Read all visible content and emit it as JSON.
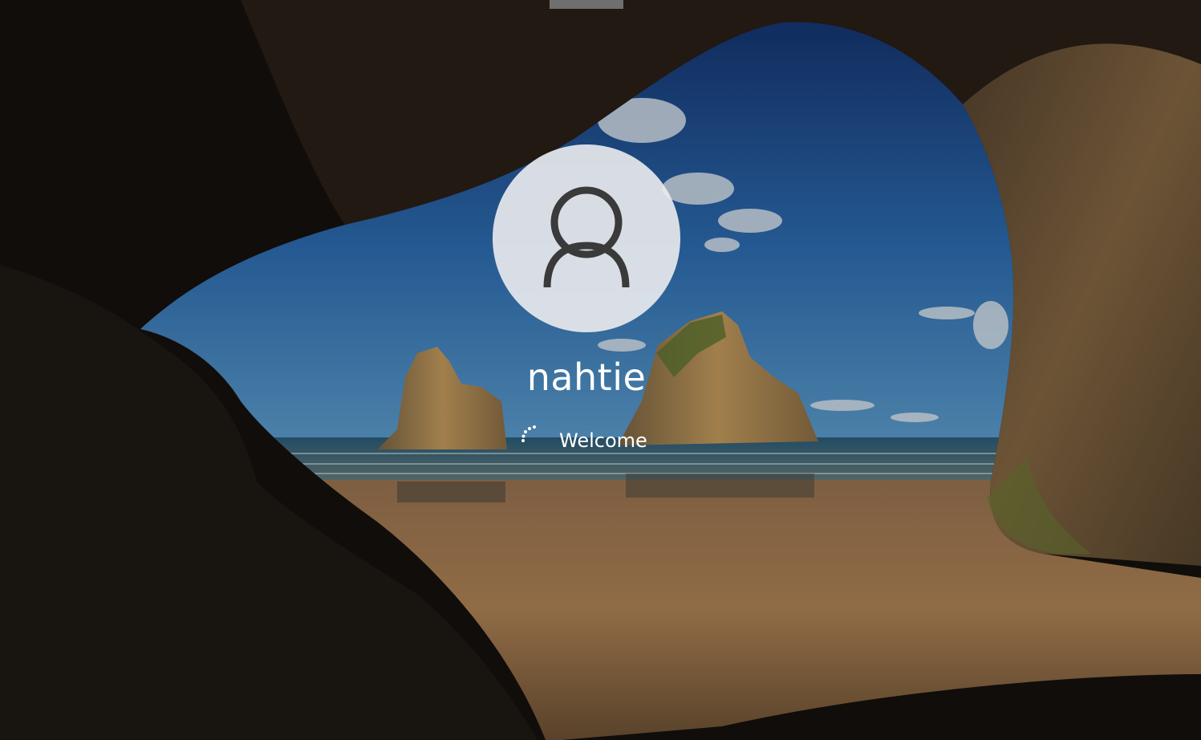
{
  "lock_screen": {
    "username": "nahtie",
    "status_text": "Welcome"
  },
  "icons": {
    "avatar": "user-silhouette-icon",
    "spinner": "loading-dots-icon"
  },
  "colors": {
    "text": "#ffffff",
    "avatar_bg": "#ececee",
    "avatar_glyph": "#3a3a3a",
    "sky": "#2e6db3",
    "sand": "#b18556",
    "cave": "#14110d"
  }
}
